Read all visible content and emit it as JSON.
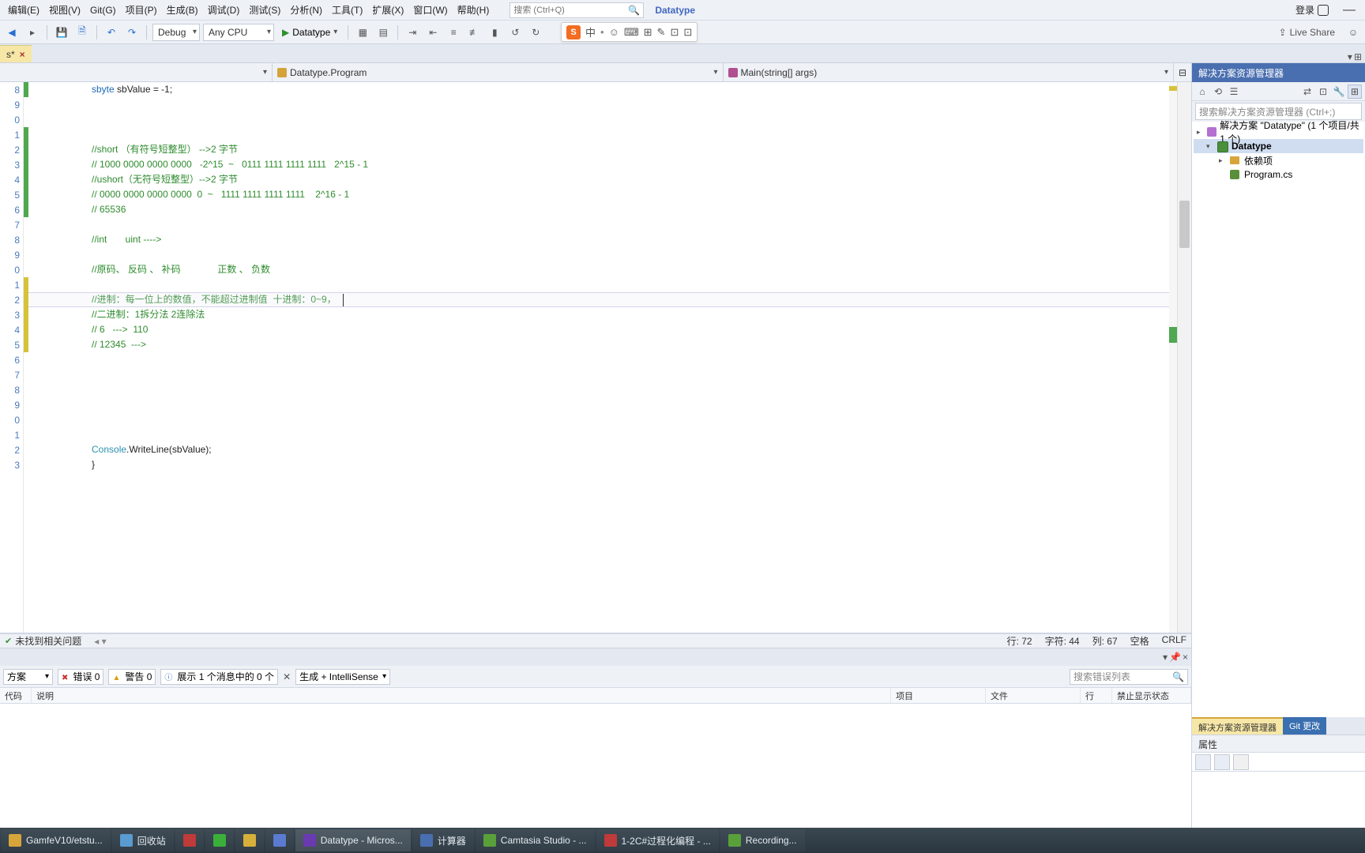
{
  "menu": {
    "items": [
      "编辑(E)",
      "视图(V)",
      "Git(G)",
      "项目(P)",
      "生成(B)",
      "调试(D)",
      "测试(S)",
      "分析(N)",
      "工具(T)",
      "扩展(X)",
      "窗口(W)",
      "帮助(H)"
    ],
    "search_placeholder": "搜索 (Ctrl+Q)",
    "appname": "Datatype",
    "login": "登录",
    "minimize": "—"
  },
  "toolbar": {
    "config": "Debug",
    "platform": "Any CPU",
    "start": "Datatype",
    "liveshare": "Live Share"
  },
  "tab": {
    "name": "s*",
    "close": "×"
  },
  "nav": {
    "left": "",
    "mid": "Datatype.Program",
    "right": "Main(string[] args)"
  },
  "gutter_start": 8,
  "code": [
    {
      "kind": "partial",
      "prefix": "sbyte sbValue = -1;",
      "cls": "kw"
    },
    {
      "kind": "blank"
    },
    {
      "kind": "blank"
    },
    {
      "kind": "blank"
    },
    {
      "kind": "comment",
      "text": "//short （有符号短整型） -->2 字节"
    },
    {
      "kind": "comment",
      "text": "// 1000 0000 0000 0000   -2^15  ~   0111 1111 1111 1111   2^15 - 1"
    },
    {
      "kind": "comment",
      "text": "//ushort（无符号短整型）-->2 字节"
    },
    {
      "kind": "comment",
      "text": "// 0000 0000 0000 0000  0  ~   1111 1111 1111 1111    2^16 - 1"
    },
    {
      "kind": "comment",
      "text": "// 65536"
    },
    {
      "kind": "blank"
    },
    {
      "kind": "comment",
      "text": "//int       uint ---->"
    },
    {
      "kind": "blank"
    },
    {
      "kind": "comment",
      "text": "//原码、 反码 、 补码              正数 、 负数"
    },
    {
      "kind": "blank"
    },
    {
      "kind": "comment",
      "text": "//进制：每一位上的数值，不能超过进制值  十进制：0~9，  ",
      "current": true
    },
    {
      "kind": "comment",
      "text": "//二进制：1拆分法 2连除法"
    },
    {
      "kind": "comment",
      "text": "// 6   --->  110"
    },
    {
      "kind": "comment",
      "text": "// 12345  --->"
    },
    {
      "kind": "blank"
    },
    {
      "kind": "blank"
    },
    {
      "kind": "blank"
    },
    {
      "kind": "blank"
    },
    {
      "kind": "blank"
    },
    {
      "kind": "blank"
    },
    {
      "kind": "call",
      "a": "Console",
      "b": ".WriteLine(sbValue);"
    },
    {
      "kind": "plain",
      "text": "}"
    }
  ],
  "status": {
    "noissues": "未找到相关问题",
    "ln": "行: 72",
    "ch": "字符: 44",
    "col": "列: 67",
    "ins": "空格",
    "crlf": "CRLF"
  },
  "err": {
    "scope": "方案",
    "err": "错误 0",
    "warn": "警告 0",
    "msg": "展示 1 个消息中的 0 个",
    "build": "生成 + IntelliSense",
    "search": "搜索错误列表",
    "cols": [
      "代码",
      "说明",
      "项目",
      "文件",
      "行",
      "禁止显示状态"
    ]
  },
  "solution": {
    "title": "解决方案资源管理器",
    "search": "搜索解决方案资源管理器 (Ctrl+;)",
    "root": "解决方案 \"Datatype\" (1 个项目/共 1 个)",
    "proj": "Datatype",
    "deps": "依赖项",
    "file": "Program.cs",
    "tab1": "解决方案资源管理器",
    "tab2": "Git 更改",
    "props": "属性"
  },
  "ime": {
    "letter": "S",
    "lang": "中",
    "icons": [
      "☺",
      "⌨",
      "⊞",
      "✎",
      "⊡",
      "⊡"
    ]
  },
  "taskbar": {
    "items": [
      {
        "label": "GamfeV10/etstu...",
        "color": "#d6a63a"
      },
      {
        "label": "回收站",
        "color": "#5a9bd0"
      },
      {
        "label": "",
        "color": "#c03a3a"
      },
      {
        "label": "",
        "color": "#3ab03a"
      },
      {
        "label": "",
        "color": "#d6b03a"
      },
      {
        "label": "",
        "color": "#5a7bd0"
      },
      {
        "label": "Datatype - Micros...",
        "color": "#6a3ab0",
        "active": true
      },
      {
        "label": "计算器",
        "color": "#4a6fb0"
      },
      {
        "label": "Camtasia Studio - ...",
        "color": "#5aa03a"
      },
      {
        "label": "1-2C#过程化编程 - ...",
        "color": "#c03a3a"
      },
      {
        "label": "Recording...",
        "color": "#5aa03a"
      }
    ]
  }
}
